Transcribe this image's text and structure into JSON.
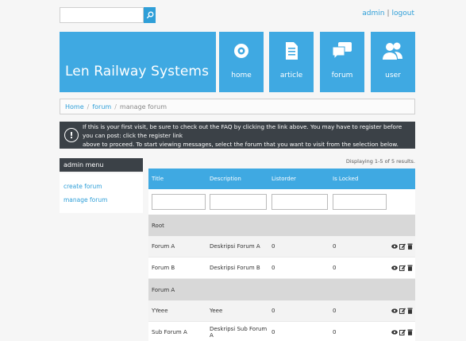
{
  "search": {
    "placeholder": ""
  },
  "top": {
    "admin": "admin",
    "separator": "|",
    "logout": "logout"
  },
  "brand": {
    "title": "Len Railway Systems",
    "color": "#3fa9e2"
  },
  "nav": [
    {
      "label": "home",
      "icon": "eye-icon"
    },
    {
      "label": "article",
      "icon": "document-icon"
    },
    {
      "label": "forum",
      "icon": "chat-icon"
    },
    {
      "label": "user",
      "icon": "users-icon"
    }
  ],
  "breadcrumb": {
    "home": "Home",
    "forum": "forum",
    "current": "manage forum",
    "separator": "/"
  },
  "notice": {
    "line1": "If this is your first visit, be sure to check out the FAQ by clicking the link above. You may have to register before you can post: click the register link",
    "line2": "above to proceed. To start viewing messages, select the forum that you want to visit from the selection below."
  },
  "sidebar": {
    "title": "admin menu",
    "links": [
      "create forum",
      "manage forum"
    ]
  },
  "grid": {
    "summary": "Displaying 1-5 of 5 results.",
    "columns": [
      "Title",
      "Description",
      "Listorder",
      "Is Locked"
    ],
    "groups": [
      {
        "name": "Root",
        "rows": [
          {
            "title": "Forum A",
            "description": "Deskripsi Forum A",
            "listorder": "0",
            "locked": "0"
          },
          {
            "title": "Forum B",
            "description": "Deskripsi Forum B",
            "listorder": "0",
            "locked": "0"
          }
        ]
      },
      {
        "name": "Forum A",
        "rows": [
          {
            "title": "YYeee",
            "description": "Yeee",
            "listorder": "0",
            "locked": "0"
          },
          {
            "title": "Sub Forum A",
            "description": "Deskripsi Sub Forum A",
            "listorder": "0",
            "locked": "0"
          }
        ]
      }
    ]
  }
}
